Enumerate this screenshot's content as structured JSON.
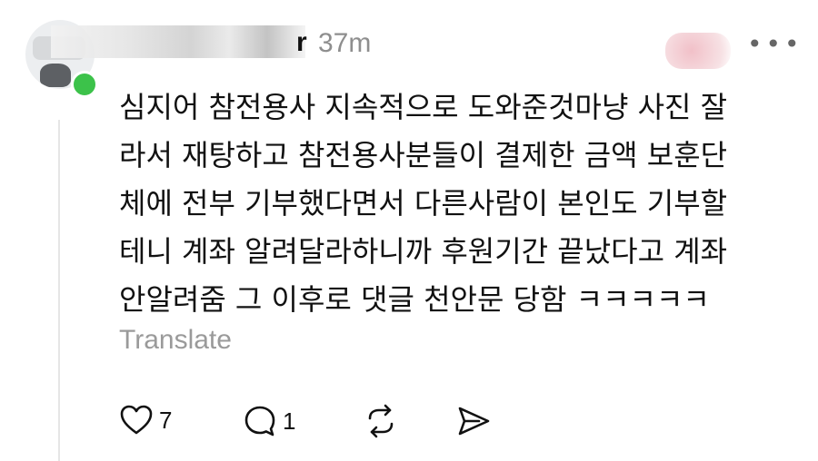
{
  "post": {
    "username_visible": "r",
    "time": "37m",
    "text_lines": [
      "심지어 참전용사 지속적으로 도와준것마냥 사진 잘",
      "라서 재탕하고 참전용사분들이 결제한 금액 보훈단",
      "체에 전부 기부했다면서 다른사람이 본인도 기부할",
      "테니 계좌 알려달라하니까 후원기간 끝났다고 계좌",
      "안알려줌 그 이후로 댓글 천안문 당함 ㅋㅋㅋㅋㅋ"
    ],
    "translate_label": "Translate"
  },
  "actions": {
    "like_count": "7",
    "reply_count": "1"
  },
  "icons": {
    "more": "more-horizontal-icon",
    "like": "heart-icon",
    "reply": "comment-icon",
    "repost": "repost-icon",
    "share": "send-icon"
  },
  "colors": {
    "online": "#3cc24a",
    "muted": "#8e8e8e"
  }
}
